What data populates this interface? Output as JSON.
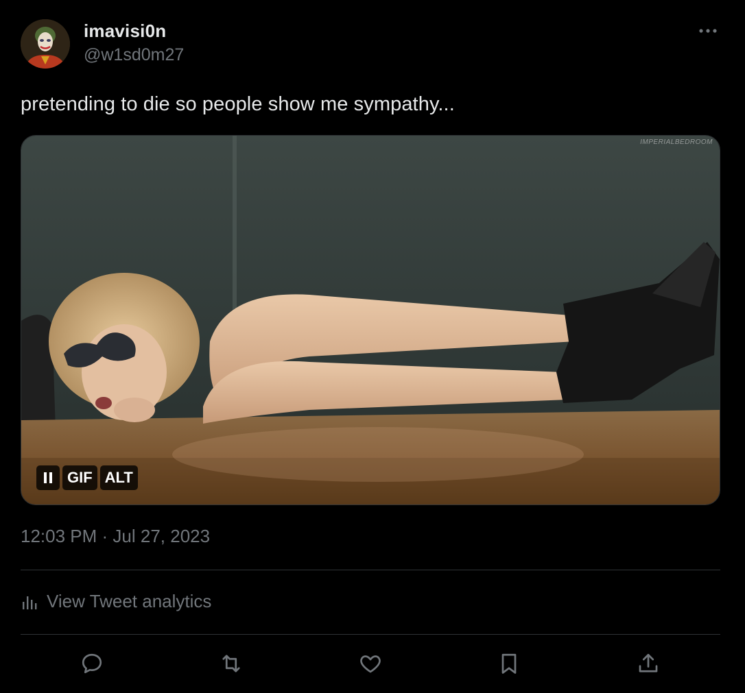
{
  "author": {
    "display_name": "imavisi0n",
    "handle": "@w1sd0m27",
    "avatar_icon": "joker-avatar"
  },
  "tweet": {
    "text": "pretending to die so people show me sympathy...",
    "timestamp": {
      "time": "12:03 PM",
      "separator": " · ",
      "date": "Jul 27, 2023"
    }
  },
  "media": {
    "watermark": "IMPERIALBEDROOM",
    "controls": {
      "pause_icon": "pause-icon",
      "gif_label": "GIF",
      "alt_label": "ALT"
    }
  },
  "analytics": {
    "label": "View Tweet analytics",
    "icon": "analytics-bars-icon"
  },
  "actions": [
    {
      "name": "reply",
      "icon": "reply-icon"
    },
    {
      "name": "retweet",
      "icon": "retweet-icon"
    },
    {
      "name": "like",
      "icon": "heart-icon"
    },
    {
      "name": "bookmark",
      "icon": "bookmark-icon"
    },
    {
      "name": "share",
      "icon": "share-icon"
    }
  ],
  "colors": {
    "background": "#000000",
    "primary_text": "#e7e9ea",
    "secondary_text": "#71767b",
    "divider": "#2f3336"
  }
}
